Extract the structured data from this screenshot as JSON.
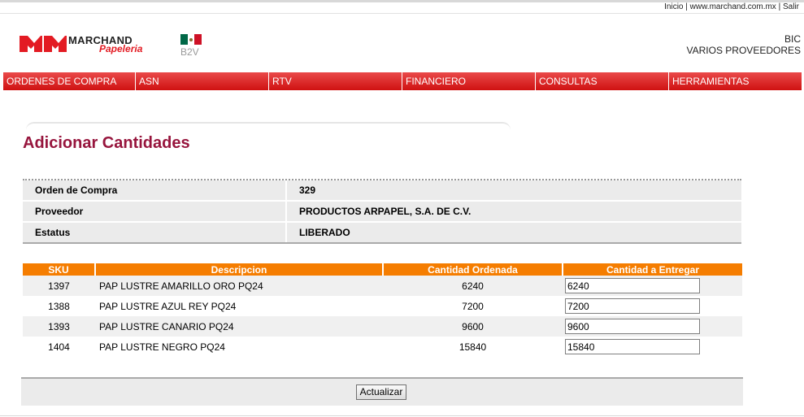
{
  "top_links": {
    "inicio": "Inicio",
    "site": "www.marchand.com.mx",
    "salir": "Salir",
    "sep": "|"
  },
  "logo": {
    "brand": "MARCHAND",
    "sub": "Papeleria",
    "colors": {
      "red": "#e31b23"
    }
  },
  "flag": {
    "colors": [
      "#006847",
      "#ffffff",
      "#ce1126"
    ]
  },
  "b2v": "B2V",
  "user": {
    "company": "BIC",
    "role": "VARIOS PROVEEDORES"
  },
  "nav": [
    {
      "label": "ORDENES DE COMPRA"
    },
    {
      "label": "ASN"
    },
    {
      "label": "RTV"
    },
    {
      "label": "FINANCIERO"
    },
    {
      "label": "CONSULTAS"
    },
    {
      "label": "HERRAMIENTAS"
    }
  ],
  "page_title": "Adicionar Cantidades",
  "info": [
    {
      "label": "Orden de Compra",
      "value": "329"
    },
    {
      "label": "Proveedor",
      "value": "PRODUCTOS ARPAPEL, S.A. DE C.V."
    },
    {
      "label": "Estatus",
      "value": "LIBERADO"
    }
  ],
  "table": {
    "headers": [
      "SKU",
      "Descripcion",
      "Cantidad Ordenada",
      "Cantidad a Entregar"
    ],
    "rows": [
      {
        "sku": "1397",
        "desc": "PAP LUSTRE AMARILLO ORO PQ24",
        "ordered": "6240",
        "deliver": "6240"
      },
      {
        "sku": "1388",
        "desc": "PAP LUSTRE AZUL REY PQ24",
        "ordered": "7200",
        "deliver": "7200"
      },
      {
        "sku": "1393",
        "desc": "PAP LUSTRE CANARIO PQ24",
        "ordered": "9600",
        "deliver": "9600"
      },
      {
        "sku": "1404",
        "desc": "PAP LUSTRE NEGRO PQ24",
        "ordered": "15840",
        "deliver": "15840"
      }
    ]
  },
  "actions": {
    "update": "Actualizar"
  },
  "colors": {
    "title": "#97153d",
    "nav_red": "#d91a1a",
    "header_orange": "#f57d00"
  }
}
